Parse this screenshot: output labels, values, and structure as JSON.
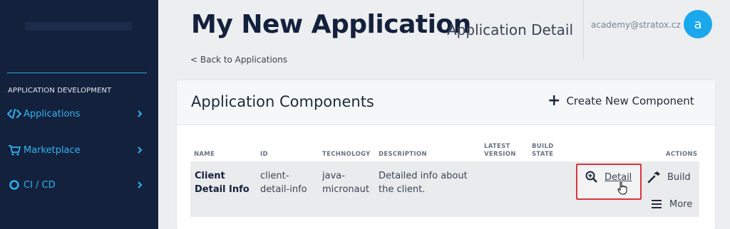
{
  "sidebar": {
    "section_title": "APPLICATION DEVELOPMENT",
    "items": [
      {
        "label": "Applications",
        "icon": "code-icon"
      },
      {
        "label": "Marketplace",
        "icon": "cart-icon"
      },
      {
        "label": "CI / CD",
        "icon": "ring-icon"
      }
    ]
  },
  "header": {
    "title": "My New Application",
    "subtitle": "Application Detail",
    "user_email": "academy@stratox.cz",
    "avatar_letter": "a",
    "back_link": "< Back to Applications"
  },
  "card": {
    "title": "Application Components",
    "create_label": "Create New Component",
    "columns": [
      "NAME",
      "ID",
      "TECHNOLOGY",
      "DESCRIPTION",
      "LATEST VERSION",
      "BUILD STATE",
      "ACTIONS"
    ],
    "rows": [
      {
        "name": "Client Detail Info",
        "id": "client-detail-info",
        "technology": "java-micronaut",
        "description": "Detailed info about the client.",
        "latest_version": "",
        "build_state": "",
        "actions": {
          "detail": "Detail",
          "build": "Build",
          "more": "More"
        }
      }
    ]
  },
  "colors": {
    "sidebar_bg": "#14213d",
    "accent": "#2fb3f0",
    "avatar": "#1aa7ec",
    "highlight": "#d9363e"
  }
}
